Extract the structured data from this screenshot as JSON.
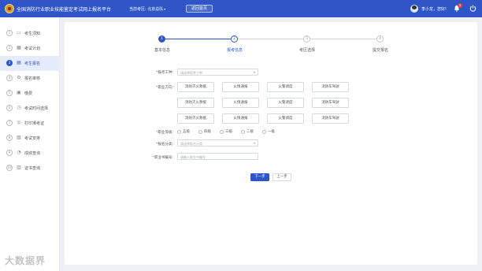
{
  "header": {
    "title": "全国消防行业职业技能鉴定考试网上报名平台",
    "region": "当前考区: 北京总队",
    "region_chevron": "▾",
    "home_button": "返回首页",
    "greeting": "李小龙，您好!",
    "notification_count": "3",
    "brand_color": "#2f55c7"
  },
  "sidebar": {
    "items": [
      {
        "num": "1",
        "icon": "book-icon",
        "label": "考生须知",
        "active": false
      },
      {
        "num": "2",
        "icon": "calendar-icon",
        "label": "考试计划",
        "active": false
      },
      {
        "num": "3",
        "icon": "form-icon",
        "label": "考生报名",
        "active": true
      },
      {
        "num": "4",
        "icon": "gear-icon",
        "label": "报名审核",
        "active": false
      },
      {
        "num": "5",
        "icon": "wallet-icon",
        "label": "缴费",
        "active": false
      },
      {
        "num": "6",
        "icon": "clock-icon",
        "label": "考试时间选择",
        "active": false
      },
      {
        "num": "7",
        "icon": "print-icon",
        "label": "打印准考证",
        "active": false
      },
      {
        "num": "8",
        "icon": "schedule-icon",
        "label": "考试安排",
        "active": false
      },
      {
        "num": "9",
        "icon": "chart-icon",
        "label": "成绩查询",
        "active": false
      },
      {
        "num": "10",
        "icon": "certificate-icon",
        "label": "证书查询",
        "active": false
      }
    ]
  },
  "steps": [
    {
      "num": "1",
      "label": "基本信息",
      "state": "done"
    },
    {
      "num": "2",
      "label": "报考信息",
      "state": "current"
    },
    {
      "num": "3",
      "label": "考区选择",
      "state": "todo"
    },
    {
      "num": "4",
      "label": "提交报名",
      "state": "todo"
    }
  ],
  "form": {
    "job_type": {
      "label": "报考工种:",
      "placeholder": "请选择报考工种"
    },
    "direction": {
      "label": "职业方向:",
      "options": [
        [
          "消防灭火救援",
          "火情通报",
          "火警调度",
          "消防车驾驶"
        ],
        [
          "消防灭火救援",
          "火情通报",
          "火警调度",
          "消防车驾驶"
        ],
        [
          "消防灭火救援",
          "火情通报",
          "火警调度",
          "消防车驾驶"
        ]
      ]
    },
    "level": {
      "label": "职业等级:",
      "options": [
        "五级",
        "四级",
        "三级",
        "二级",
        "一级"
      ]
    },
    "apply_type": {
      "label": "报名分类:",
      "placeholder": "请选择报名分类"
    },
    "cert_no": {
      "label": "职业书编号:",
      "placeholder": "请输入职业书编号"
    }
  },
  "buttons": {
    "next": "下一步",
    "prev": "上一步"
  },
  "watermark": "大数据界"
}
